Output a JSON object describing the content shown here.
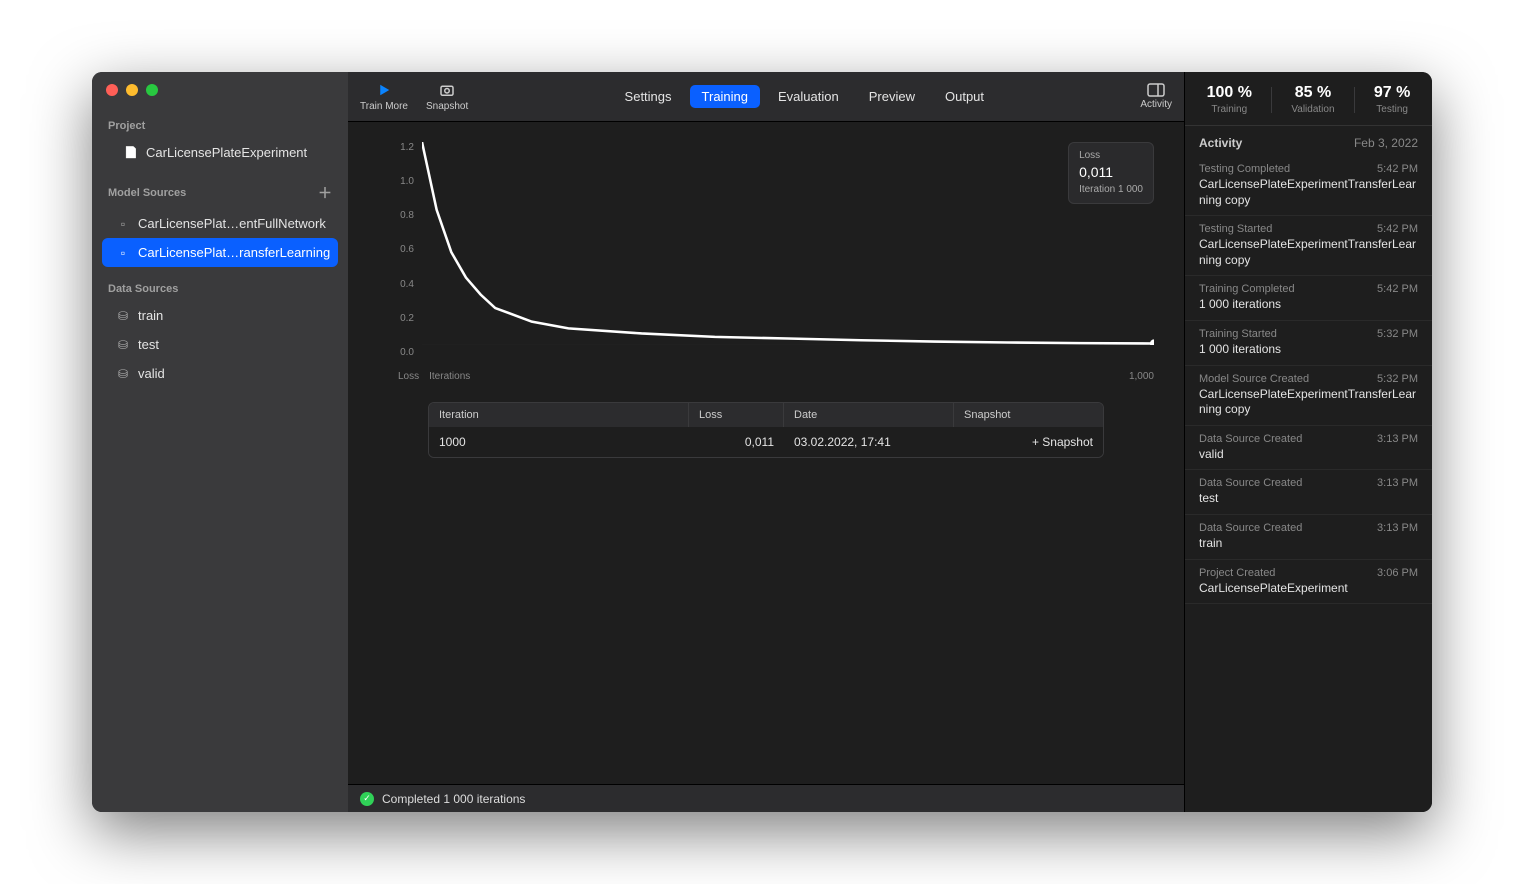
{
  "sidebar": {
    "project_label": "Project",
    "project_name": "CarLicensePlateExperiment",
    "model_sources_label": "Model Sources",
    "models": [
      {
        "label": "CarLicensePlat…entFullNetwork"
      },
      {
        "label": "CarLicensePlat…ransferLearning"
      }
    ],
    "data_sources_label": "Data Sources",
    "data_sources": [
      {
        "label": "train"
      },
      {
        "label": "test"
      },
      {
        "label": "valid"
      }
    ]
  },
  "toolbar": {
    "train_more": "Train More",
    "snapshot": "Snapshot",
    "activity": "Activity",
    "tabs": [
      "Settings",
      "Training",
      "Evaluation",
      "Preview",
      "Output"
    ],
    "active_tab": 1
  },
  "metrics": [
    {
      "pct": "100 %",
      "lbl": "Training"
    },
    {
      "pct": "85 %",
      "lbl": "Validation"
    },
    {
      "pct": "97 %",
      "lbl": "Testing"
    }
  ],
  "chart_info": {
    "loss_label": "Loss",
    "loss_value": "0,011",
    "iteration_label": "Iteration 1 000"
  },
  "chart_axis": {
    "loss_label": "Loss",
    "iter_label": "Iterations",
    "xmax": "1,000"
  },
  "chart_data": {
    "type": "line",
    "title": "",
    "xlabel": "Iterations",
    "ylabel": "Loss",
    "xlim": [
      0,
      1000
    ],
    "ylim": [
      0.0,
      1.2
    ],
    "yticks": [
      0.0,
      0.2,
      0.4,
      0.6,
      0.8,
      1.0,
      1.2
    ],
    "series": [
      {
        "name": "Loss",
        "x": [
          0,
          20,
          40,
          60,
          80,
          100,
          150,
          200,
          300,
          400,
          500,
          600,
          700,
          800,
          900,
          1000
        ],
        "values": [
          1.2,
          0.8,
          0.55,
          0.4,
          0.3,
          0.22,
          0.14,
          0.1,
          0.07,
          0.05,
          0.04,
          0.03,
          0.022,
          0.017,
          0.013,
          0.011
        ]
      }
    ]
  },
  "table": {
    "headers": [
      "Iteration",
      "Loss",
      "Date",
      "Snapshot"
    ],
    "rows": [
      {
        "iteration": "1000",
        "loss": "0,011",
        "date": "03.02.2022, 17:41",
        "snapshot": "+ Snapshot"
      }
    ]
  },
  "activity": {
    "header": "Activity",
    "date": "Feb 3, 2022",
    "items": [
      {
        "title": "Testing Completed",
        "time": "5:42 PM",
        "detail": "CarLicensePlateExperimentTransferLearning copy"
      },
      {
        "title": "Testing Started",
        "time": "5:42 PM",
        "detail": "CarLicensePlateExperimentTransferLearning copy"
      },
      {
        "title": "Training Completed",
        "time": "5:42 PM",
        "detail": "1 000 iterations"
      },
      {
        "title": "Training Started",
        "time": "5:32 PM",
        "detail": "1 000 iterations"
      },
      {
        "title": "Model Source Created",
        "time": "5:32 PM",
        "detail": "CarLicensePlateExperimentTransferLearning copy"
      },
      {
        "title": "Data Source Created",
        "time": "3:13 PM",
        "detail": "valid"
      },
      {
        "title": "Data Source Created",
        "time": "3:13 PM",
        "detail": "test"
      },
      {
        "title": "Data Source Created",
        "time": "3:13 PM",
        "detail": "train"
      },
      {
        "title": "Project Created",
        "time": "3:06 PM",
        "detail": "CarLicensePlateExperiment"
      }
    ]
  },
  "status": "Completed 1 000 iterations"
}
